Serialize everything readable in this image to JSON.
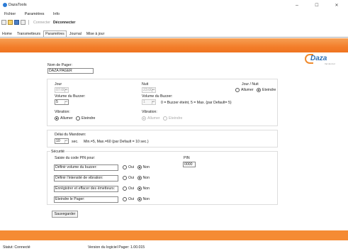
{
  "window": {
    "title": "DazaTools",
    "minimize": "–",
    "maximize": "☐",
    "close": "✕"
  },
  "menu": [
    "Fichier",
    "Paramètres",
    "Info"
  ],
  "toolbar": {
    "connect": "Connecter",
    "disconnect": "Déconnecter"
  },
  "tabs": [
    "Home",
    "Transmetteurs",
    "Paramètres",
    "Journal",
    "Mise à jour"
  ],
  "logo": {
    "text": "Daza",
    "sub": "Ver de tout"
  },
  "pager": {
    "name_label": "Nom de Pager:",
    "name_value": "DAZA PAGER"
  },
  "day": {
    "label": "Jour",
    "time": "07:00",
    "buzzer_label": "Volume du Buzzer:",
    "buzzer_value": "5",
    "vibration_label": "Vibration:",
    "on": "Allumer",
    "off": "Eteindre"
  },
  "night": {
    "label": "Nuit",
    "time": "23:00",
    "buzzer_label": "Volume du Buzzer:",
    "buzzer_value": "1",
    "buzzer_hint": "0 = Buzzer éteint, 5 = Max. (par Default= 5)",
    "vibration_label": "Vibration:",
    "on": "Allumer",
    "off": "Eteindre"
  },
  "daynight": {
    "label": "Jour / Nuit",
    "on": "Allumer",
    "off": "Eteindre"
  },
  "mandown": {
    "label": "Délai du Mandown:",
    "value": "10",
    "unit": "sec.",
    "hint": "Min.=5, Max.=60 (par Default = 10 sec.)"
  },
  "security": {
    "label": "Sécurité",
    "pin_prompt": "Saisie du code PIN pour:",
    "pin_label": "PIN",
    "pin_value": "0000",
    "yes": "Oui",
    "no": "Non",
    "rows": [
      "Définir volume du buzzer:",
      "Définir l'intensité de vibration:",
      "Enrégistrer et effacer des émetteurs:",
      "Eteindre le Pager:"
    ]
  },
  "save_button": "Sauvegarder",
  "status": {
    "text": "Statut: Connecté",
    "version": "Version du logiciel Pager: 1.00.015"
  }
}
